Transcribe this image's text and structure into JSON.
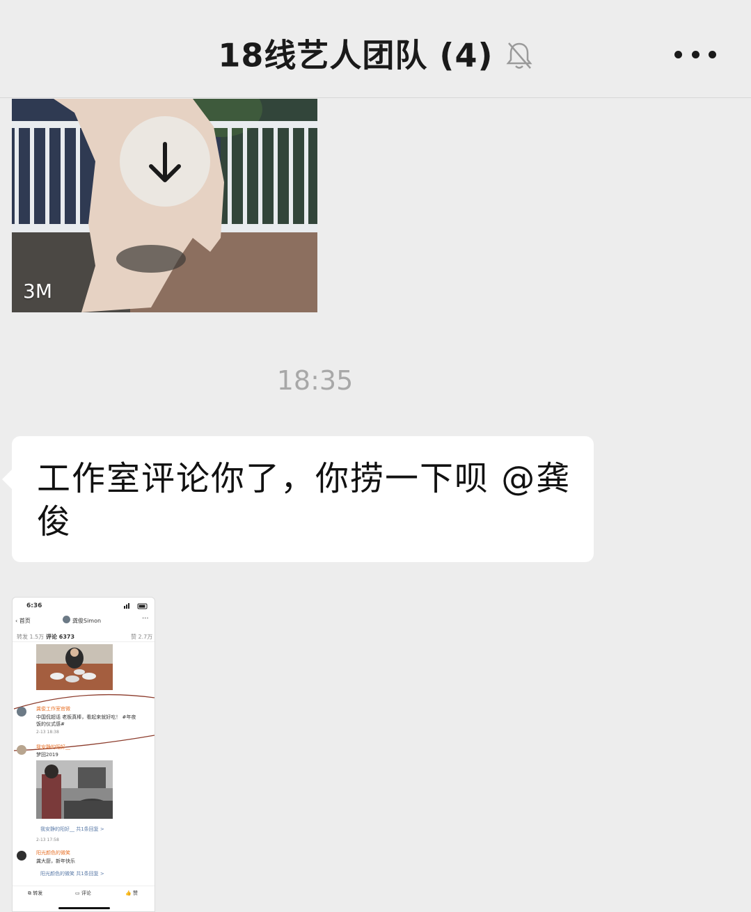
{
  "header": {
    "title": "18线艺人团队 (4)",
    "mute_icon": "bell-slash-icon",
    "more_icon": "more-dots-icon"
  },
  "messages": [
    {
      "type": "video",
      "size_label": "3M",
      "action_icon": "download-arrow-icon"
    },
    {
      "type": "timestamp",
      "text": "18:35"
    },
    {
      "type": "text",
      "text": "工作室评论你了，你捞一下呗 @龚俊"
    },
    {
      "type": "image",
      "screenshot": {
        "status_time": "6:36",
        "back_label": "首页",
        "account_name": "龚俊Simon",
        "tabs": {
          "repost": "转发 1.5万",
          "comment": "评论 6373",
          "like": "赞 2.7万"
        },
        "comment1": {
          "author": "龚俊工作室官微",
          "text1": "中国侃超话 老板真棒，看起来就好吃",
          "text1_tail": "！ #年夜",
          "text2": "饭的仪式感#",
          "time": "2-13 18:38"
        },
        "comment2": {
          "author": "我安静的阳好__",
          "text": "梦回2019",
          "reply_link": "我安静的阳好__  共1条回复 >",
          "time": "2-13 17:58"
        },
        "comment3": {
          "author": "阳光颜色的微笑",
          "text": "龚大厨，新年快乐",
          "reply_link": "阳光颜色的微笑  共1条回复 >"
        },
        "bottom_bar": {
          "repost": "转发",
          "comment": "评论",
          "like": "赞"
        }
      }
    }
  ],
  "colors": {
    "background": "#ededed",
    "bubble": "#ffffff",
    "timestamp": "#a8a8a8",
    "accent_orange": "#e8742c"
  }
}
